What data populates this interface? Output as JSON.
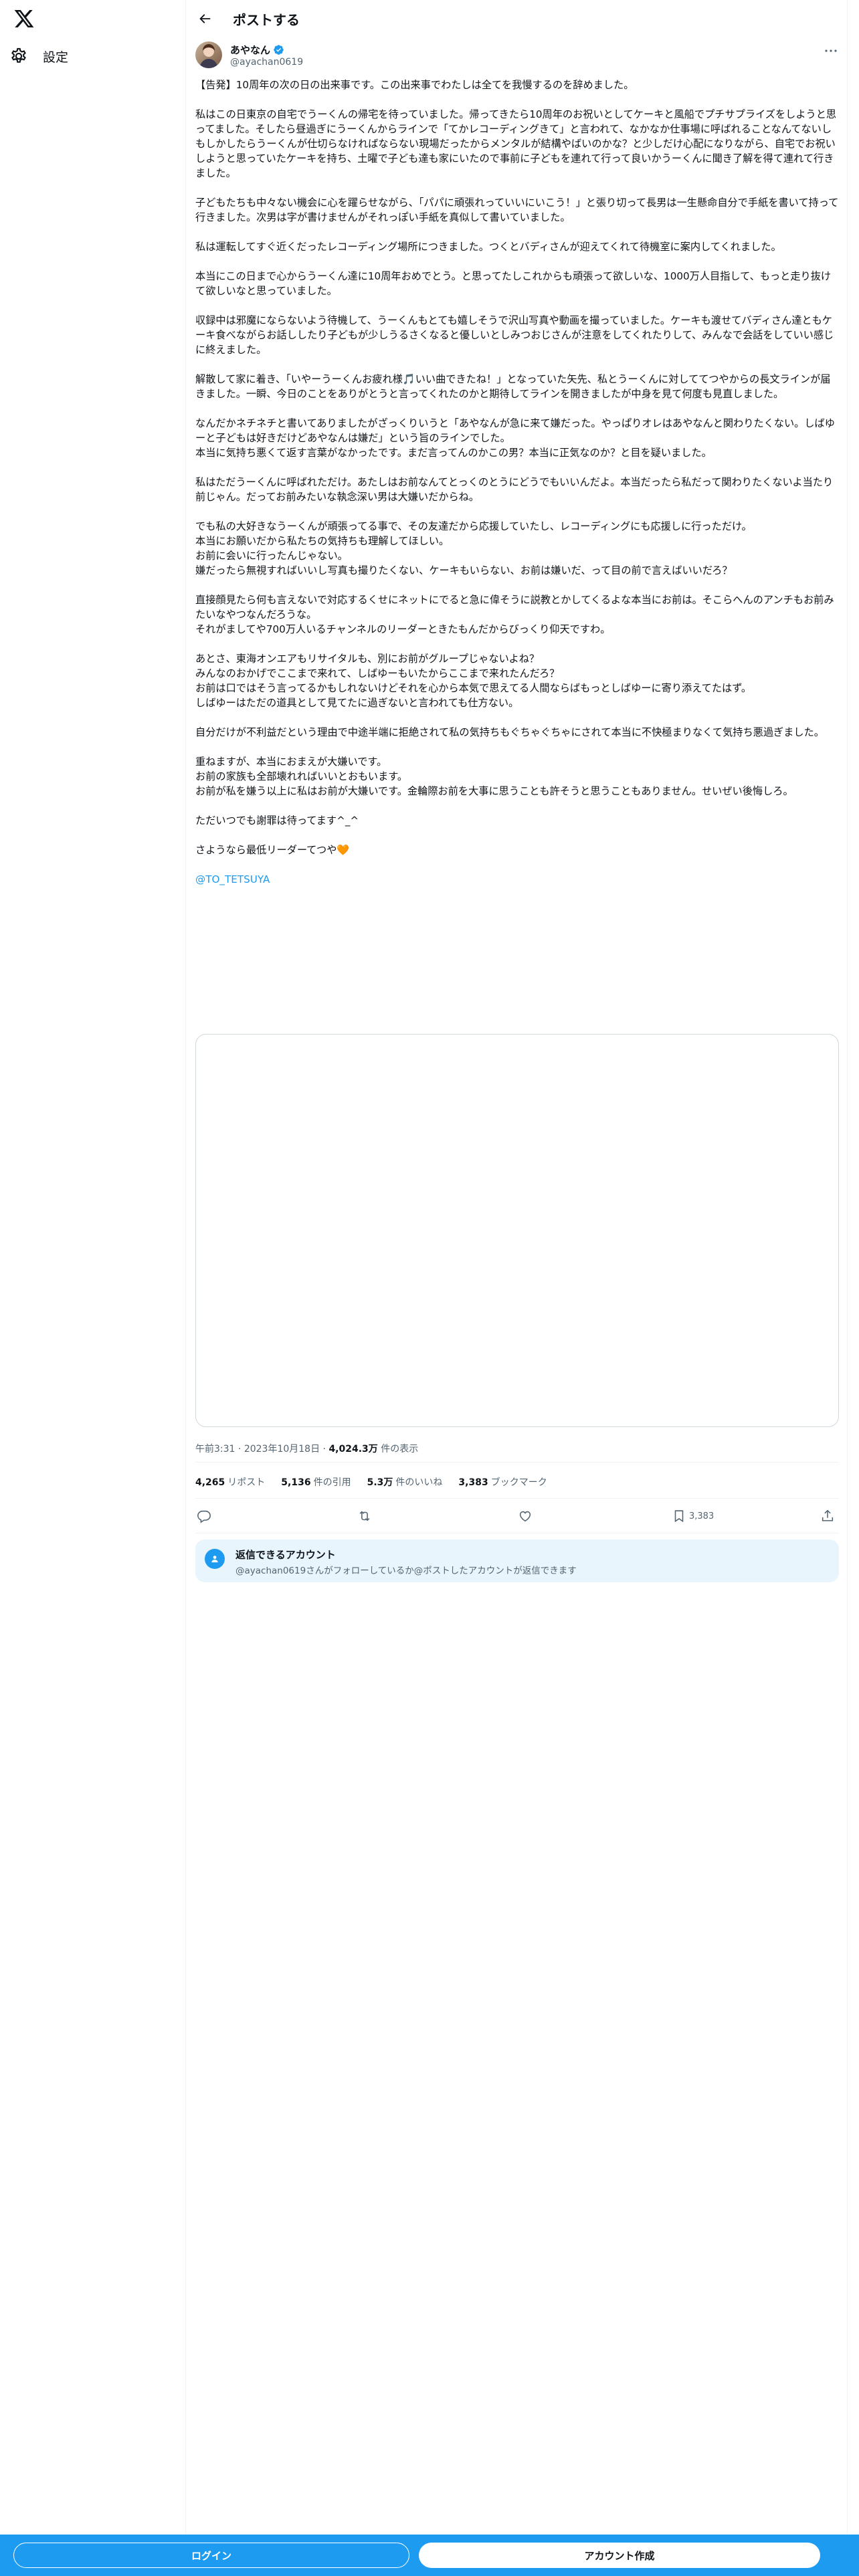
{
  "nav": {
    "settings_label": "設定"
  },
  "header": {
    "title": "ポストする"
  },
  "author": {
    "name": "あやなん",
    "handle": "@ayachan0619"
  },
  "post": {
    "paragraphs": [
      [
        "【告発】10周年の次の日の出来事です。この出来事でわたしは全てを我慢するのを辞めました。"
      ],
      [
        "私はこの日東京の自宅でうーくんの帰宅を待っていました。帰ってきたら10周年のお祝いとしてケーキと風船でプチサプライズをしようと思ってました。そしたら昼過ぎにうーくんからラインで「てかレコーディングきて」と言われて、なかなか仕事場に呼ばれることなんてないしもしかしたらうーくんが仕切らなければならない現場だったからメンタルが結構やばいのかな？と少しだけ心配になりながら、自宅でお祝いしようと思っていたケーキを持ち、土曜で子ども達も家にいたので事前に子どもを連れて行って良いかうーくんに聞き了解を得て連れて行きました。"
      ],
      [
        "子どもたちも中々ない機会に心を躍らせながら、「パパに頑張れっていいにいこう！」と張り切って長男は一生懸命自分で手紙を書いて持って行きました。次男は字が書けませんがそれっぽい手紙を真似して書いていました。"
      ],
      [
        "私は運転してすぐ近くだったレコーディング場所につきました。つくとバディさんが迎えてくれて待機室に案内してくれました。"
      ],
      [
        "本当にこの日まで心からうーくん達に10周年おめでとう。と思ってたしこれからも頑張って欲しいな、1000万人目指して、もっと走り抜けて欲しいなと思っていました。"
      ],
      [
        "収録中は邪魔にならないよう待機して、うーくんもとても嬉しそうで沢山写真や動画を撮っていました。ケーキも渡せてバディさん達ともケーキ食べながらお話ししたり子どもが少しうるさくなると優しいとしみつおじさんが注意をしてくれたりして、みんなで会話をしていい感じに終えました。"
      ],
      [
        "解散して家に着き、「いやーうーくんお疲れ様🎵いい曲できたね！」となっていた矢先、私とうーくんに対しててつやからの長文ラインが届きました。一瞬、今日のことをありがとうと言ってくれたのかと期待してラインを開きましたが中身を見て何度も見直しました。"
      ],
      [
        "なんだかネチネチと書いてありましたがざっくりいうと「あやなんが急に来て嫌だった。やっぱりオレはあやなんと関わりたくない。しばゆーと子どもは好きだけどあやなんは嫌だ」という旨のラインでした。",
        "本当に気持ち悪くて返す言葉がなかったです。まだ言ってんのかこの男？本当に正気なのか？と目を疑いました。"
      ],
      [
        "私はただうーくんに呼ばれただけ。あたしはお前なんてとっくのとうにどうでもいいんだよ。本当だったら私だって関わりたくないよ当たり前じゃん。だってお前みたいな執念深い男は大嫌いだからね。"
      ],
      [
        "でも私の大好きなうーくんが頑張ってる事で、その友達だから応援していたし、レコーディングにも応援しに行っただけ。",
        "本当にお願いだから私たちの気持ちも理解してほしい。",
        "お前に会いに行ったんじゃない。",
        "嫌だったら無視すればいいし写真も撮りたくない、ケーキもいらない、お前は嫌いだ、って目の前で言えばいいだろ？"
      ],
      [
        "直接顔見たら何も言えないで対応するくせにネットにでると急に偉そうに説教とかしてくるよな本当にお前は。そこらへんのアンチもお前みたいなやつなんだろうな。",
        "それがましてや700万人いるチャンネルのリーダーときたもんだからびっくり仰天ですわ。"
      ],
      [
        "あとさ、東海オンエアもリサイタルも、別にお前がグループじゃないよね？",
        "みんなのおかげでここまで来れて、しばゆーもいたからここまで来れたんだろ？",
        "お前は口ではそう言ってるかもしれないけどそれを心から本気で思えてる人間ならばもっとしばゆーに寄り添えてたはず。",
        "しばゆーはただの道具として見てたに過ぎないと言われても仕方ない。"
      ],
      [
        "自分だけが不利益だという理由で中途半端に拒絶されて私の気持ちもぐちゃぐちゃにされて本当に不快極まりなくて気持ち悪過ぎました。"
      ],
      [
        "重ねますが、本当におまえが大嫌いです。",
        "お前の家族も全部壊れればいいとおもいます。",
        "お前が私を嫌う以上に私はお前が大嫌いです。金輪際お前を大事に思うことも許そうと思うこともありません。せいぜい後悔しろ。"
      ],
      [
        "ただいつでも謝罪は待ってます^_^"
      ],
      [
        "さようなら最低リーダーてつや🧡"
      ]
    ],
    "mention": "@TO_TETSUYA",
    "time": "午前3:31",
    "date": "2023年10月18日",
    "views_value": "4,024.3万",
    "views_label": "件の表示"
  },
  "stats": {
    "reposts_value": "4,265",
    "reposts_label": "リポスト",
    "quotes_value": "5,136",
    "quotes_label": "件の引用",
    "likes_value": "5.3万",
    "likes_label": "件のいいね",
    "bookmarks_value": "3,383",
    "bookmarks_label": "ブックマーク"
  },
  "actions": {
    "bookmark_count": "3,383"
  },
  "reply_notice": {
    "title": "返信できるアカウント",
    "description": "@ayachan0619さんがフォローしているか@ポストしたアカウントが返信できます"
  },
  "bottom": {
    "login_label": "ログイン",
    "signup_label": "アカウント作成"
  },
  "colors": {
    "accent": "#1d9bf0",
    "text": "#0f1419",
    "muted": "#536471"
  }
}
